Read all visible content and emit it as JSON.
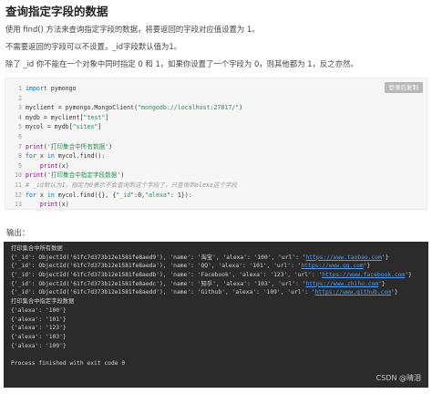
{
  "title": "查询指定字段的数据",
  "paragraphs": [
    "使用 find() 方法来查询指定字段的数据，将要返回的字段对应值设置为 1。",
    "不需要返回的字段可以不设置，_id字段默认值为1。",
    "除了 _id 你不能在一个对象中同时指定 0 和 1，如果你设置了一个字段为 0，则其他都为 1，反之亦然。"
  ],
  "copy_button": "登录后复制",
  "code_lines": [
    {
      "n": "1",
      "parts": [
        {
          "t": "kw",
          "v": "import"
        },
        {
          "t": "ct",
          "v": " pymongo"
        }
      ]
    },
    {
      "n": "2",
      "parts": []
    },
    {
      "n": "3",
      "parts": [
        {
          "t": "ct",
          "v": "myclient = pymongo.MongoClient("
        },
        {
          "t": "str",
          "v": "\"mongodb://localhost:27017/\""
        },
        {
          "t": "ct",
          "v": ")"
        }
      ]
    },
    {
      "n": "4",
      "parts": [
        {
          "t": "ct",
          "v": "mydb = myclient["
        },
        {
          "t": "str",
          "v": "\"test\""
        },
        {
          "t": "ct",
          "v": "]"
        }
      ]
    },
    {
      "n": "5",
      "parts": [
        {
          "t": "ct",
          "v": "mycol = mydb["
        },
        {
          "t": "str",
          "v": "\"sites\""
        },
        {
          "t": "ct",
          "v": "]"
        }
      ]
    },
    {
      "n": "6",
      "parts": []
    },
    {
      "n": "7",
      "parts": [
        {
          "t": "fn",
          "v": "print"
        },
        {
          "t": "ct",
          "v": "("
        },
        {
          "t": "str",
          "v": "'打印集合中所有数据'"
        },
        {
          "t": "ct",
          "v": ")"
        }
      ]
    },
    {
      "n": "8",
      "parts": [
        {
          "t": "kw",
          "v": "for"
        },
        {
          "t": "ct",
          "v": " x "
        },
        {
          "t": "kw",
          "v": "in"
        },
        {
          "t": "ct",
          "v": " mycol.find():"
        }
      ]
    },
    {
      "n": "9",
      "parts": [
        {
          "t": "ct",
          "v": "    "
        },
        {
          "t": "fn",
          "v": "print"
        },
        {
          "t": "ct",
          "v": "(x)"
        }
      ]
    },
    {
      "n": "10",
      "parts": [
        {
          "t": "fn",
          "v": "print"
        },
        {
          "t": "ct",
          "v": "("
        },
        {
          "t": "str",
          "v": "'打印集合中指定字段数据'"
        },
        {
          "t": "ct",
          "v": ")"
        }
      ]
    },
    {
      "n": "11",
      "parts": [
        {
          "t": "cm",
          "v": "# _id默认为1，指定为0表示不会查询到这个字段了，只查询到alexa这个字段"
        }
      ]
    },
    {
      "n": "12",
      "parts": [
        {
          "t": "kw",
          "v": "for"
        },
        {
          "t": "ct",
          "v": " x "
        },
        {
          "t": "kw",
          "v": "in"
        },
        {
          "t": "ct",
          "v": " mycol.find({}, {"
        },
        {
          "t": "str",
          "v": "\"_id\""
        },
        {
          "t": "ct",
          "v": ":0,"
        },
        {
          "t": "str",
          "v": "\"alexa\""
        },
        {
          "t": "ct",
          "v": ": 1}):"
        }
      ]
    },
    {
      "n": "13",
      "parts": [
        {
          "t": "ct",
          "v": "    "
        },
        {
          "t": "fn",
          "v": "print"
        },
        {
          "t": "ct",
          "v": "(x)"
        }
      ]
    }
  ],
  "output_label": "输出：",
  "terminal_lines": [
    {
      "parts": [
        {
          "t": "txt",
          "v": "打印集合中所有数据"
        }
      ]
    },
    {
      "parts": [
        {
          "t": "txt",
          "v": "{'_id': ObjectId('61fc7d373b12e1581fe8aed9'), 'name': '淘宝', 'alexa': '100', 'url': '"
        },
        {
          "t": "lnk",
          "v": "https://www.taobao.com"
        },
        {
          "t": "txt",
          "v": "'}"
        }
      ]
    },
    {
      "parts": [
        {
          "t": "txt",
          "v": "{'_id': ObjectId('61fc7d373b12e1581fe8aeda'), 'name': 'QQ', 'alexa': '101', 'url': '"
        },
        {
          "t": "lnk",
          "v": "https://www.qq.com"
        },
        {
          "t": "txt",
          "v": "'}"
        }
      ]
    },
    {
      "parts": [
        {
          "t": "txt",
          "v": "{'_id': ObjectId('61fc7d373b12e1581fe8aedb'), 'name': 'Facebook', 'alexa': '123', 'url': '"
        },
        {
          "t": "lnk",
          "v": "https://www.facebook.com"
        },
        {
          "t": "txt",
          "v": "'}"
        }
      ]
    },
    {
      "parts": [
        {
          "t": "txt",
          "v": "{'_id': ObjectId('61fc7d373b12e1581fe8aedc'), 'name': '知乎', 'alexa': '103', 'url': '"
        },
        {
          "t": "lnk",
          "v": "https://www.zhihu.com"
        },
        {
          "t": "txt",
          "v": "'}"
        }
      ]
    },
    {
      "parts": [
        {
          "t": "txt",
          "v": "{'_id': ObjectId('61fc7d373b12e1581fe8aedd'), 'name': 'Github', 'alexa': '109', 'url': '"
        },
        {
          "t": "lnk",
          "v": "https://www.github.com"
        },
        {
          "t": "txt",
          "v": "'}"
        }
      ]
    },
    {
      "parts": [
        {
          "t": "txt",
          "v": "打印集合中指定字段数据"
        }
      ]
    },
    {
      "parts": [
        {
          "t": "txt",
          "v": "{'alexa': '100'}"
        }
      ]
    },
    {
      "parts": [
        {
          "t": "txt",
          "v": "{'alexa': '101'}"
        }
      ]
    },
    {
      "parts": [
        {
          "t": "txt",
          "v": "{'alexa': '123'}"
        }
      ]
    },
    {
      "parts": [
        {
          "t": "txt",
          "v": "{'alexa': '103'}"
        }
      ]
    },
    {
      "parts": [
        {
          "t": "txt",
          "v": "{'alexa': '109'}"
        }
      ]
    },
    {
      "parts": []
    },
    {
      "parts": [
        {
          "t": "txt",
          "v": "Process finished with exit code 0"
        }
      ]
    }
  ],
  "watermark": "CSDN @晴泪"
}
